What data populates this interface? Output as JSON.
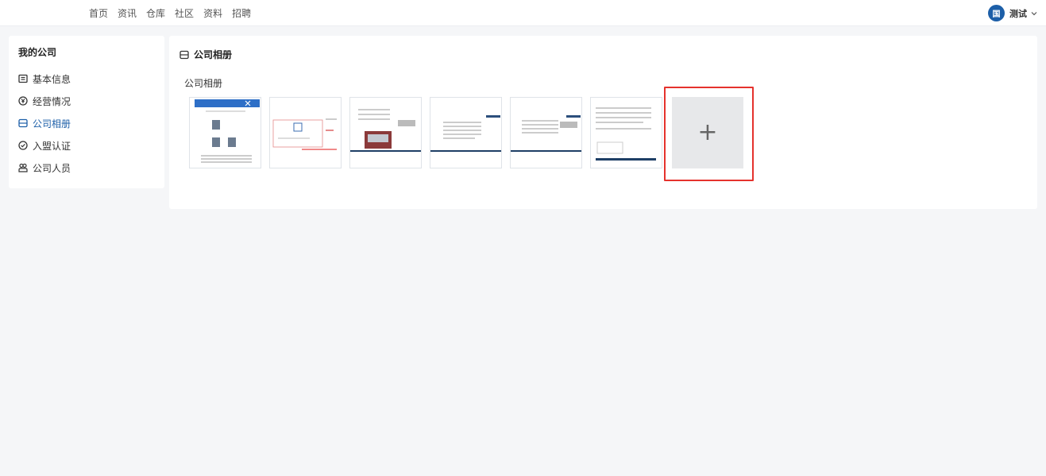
{
  "nav": {
    "items": [
      {
        "label": "首页"
      },
      {
        "label": "资讯"
      },
      {
        "label": "仓库"
      },
      {
        "label": "社区"
      },
      {
        "label": "资料"
      },
      {
        "label": "招聘"
      }
    ]
  },
  "user": {
    "avatar_text": "国",
    "name": "测试",
    "dropdown_icon": "chevron-down-icon"
  },
  "sidebar": {
    "title": "我的公司",
    "items": [
      {
        "label": "基本信息",
        "icon": "id-card-icon"
      },
      {
        "label": "经营情况",
        "icon": "yen-circle-icon"
      },
      {
        "label": "公司相册",
        "icon": "album-icon",
        "active": true
      },
      {
        "label": "入盟认证",
        "icon": "check-circle-icon"
      },
      {
        "label": "公司人员",
        "icon": "users-icon"
      }
    ]
  },
  "main": {
    "header": "公司相册",
    "header_icon": "album-icon",
    "section_label": "公司相册",
    "photos": [
      {
        "name": "photo-1"
      },
      {
        "name": "photo-2"
      },
      {
        "name": "photo-3"
      },
      {
        "name": "photo-4"
      },
      {
        "name": "photo-5"
      },
      {
        "name": "photo-6"
      }
    ],
    "upload_symbol": "+",
    "colors": {
      "accent": "#1d5fa8",
      "highlight_border": "#e5322d",
      "background": "#f5f6f8"
    }
  }
}
